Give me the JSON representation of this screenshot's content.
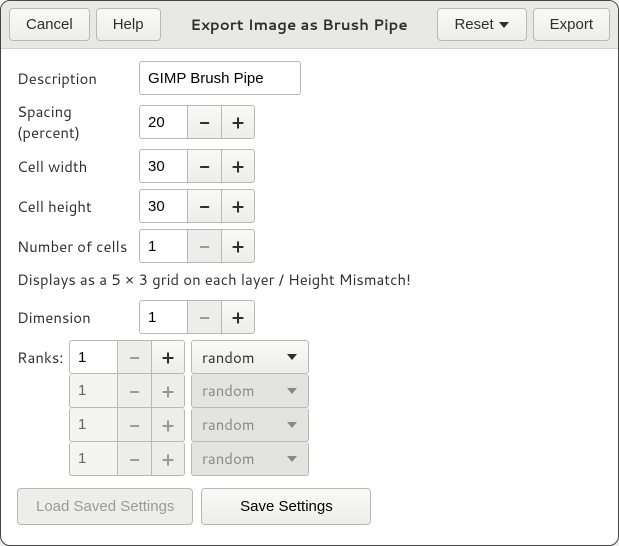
{
  "header": {
    "cancel": "Cancel",
    "help": "Help",
    "title": "Export Image as Brush Pipe",
    "reset": "Reset",
    "export": "Export"
  },
  "fields": {
    "description_label": "Description",
    "description_value": "GIMP Brush Pipe",
    "spacing_label": "Spacing (percent)",
    "spacing_value": "20",
    "cell_width_label": "Cell width",
    "cell_width_value": "30",
    "cell_height_label": "Cell height",
    "cell_height_value": "30",
    "number_cells_label": "Number of cells",
    "number_cells_value": "1",
    "status": "Displays as a 5 × 3 grid on each layer / Height Mismatch!",
    "dimension_label": "Dimension",
    "dimension_value": "1"
  },
  "ranks": {
    "label": "Ranks:",
    "rows": [
      {
        "value": "1",
        "mode": "random",
        "enabled": true
      },
      {
        "value": "1",
        "mode": "random",
        "enabled": false
      },
      {
        "value": "1",
        "mode": "random",
        "enabled": false
      },
      {
        "value": "1",
        "mode": "random",
        "enabled": false
      }
    ]
  },
  "footer": {
    "load": "Load Saved Settings",
    "save": "Save Settings"
  }
}
